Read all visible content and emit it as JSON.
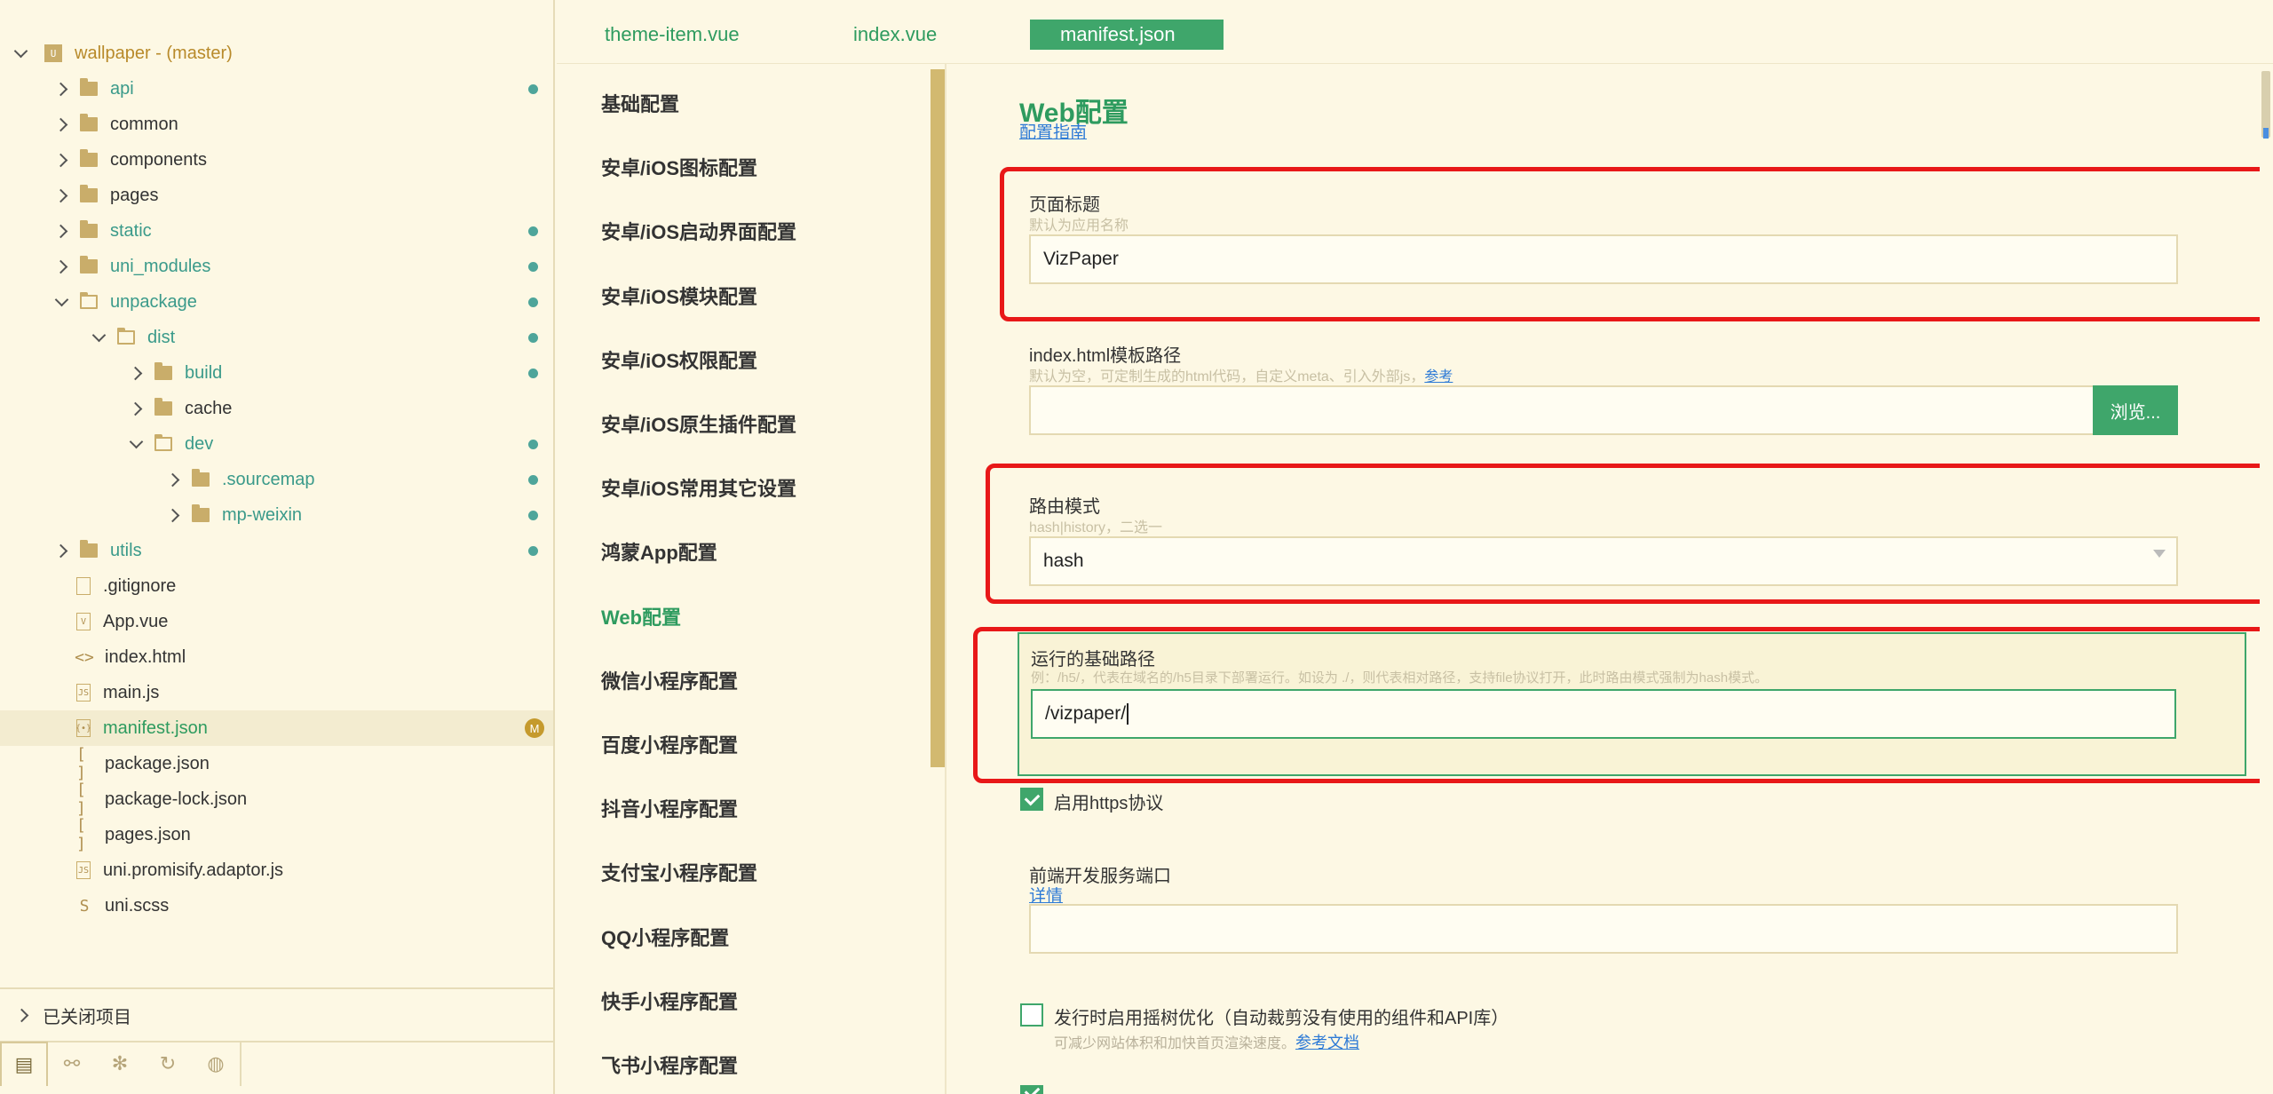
{
  "project": {
    "name": "wallpaper",
    "branch": " - (master)"
  },
  "file_tree": [
    {
      "label": "api",
      "kind": "folder",
      "depth": 1,
      "expanded": false,
      "color": "teal",
      "dot": true
    },
    {
      "label": "common",
      "kind": "folder",
      "depth": 1,
      "expanded": false,
      "color": "dark",
      "dot": false
    },
    {
      "label": "components",
      "kind": "folder",
      "depth": 1,
      "expanded": false,
      "color": "dark",
      "dot": false
    },
    {
      "label": "pages",
      "kind": "folder",
      "depth": 1,
      "expanded": false,
      "color": "dark",
      "dot": false
    },
    {
      "label": "static",
      "kind": "folder",
      "depth": 1,
      "expanded": false,
      "color": "teal",
      "dot": true
    },
    {
      "label": "uni_modules",
      "kind": "folder",
      "depth": 1,
      "expanded": false,
      "color": "teal",
      "dot": true
    },
    {
      "label": "unpackage",
      "kind": "folder",
      "depth": 1,
      "expanded": true,
      "color": "teal",
      "dot": true
    },
    {
      "label": "dist",
      "kind": "folder",
      "depth": 2,
      "expanded": true,
      "color": "teal",
      "dot": true
    },
    {
      "label": "build",
      "kind": "folder",
      "depth": 3,
      "expanded": false,
      "color": "teal",
      "dot": true
    },
    {
      "label": "cache",
      "kind": "folder",
      "depth": 3,
      "expanded": false,
      "color": "dark",
      "dot": false
    },
    {
      "label": "dev",
      "kind": "folder",
      "depth": 3,
      "expanded": true,
      "color": "teal",
      "dot": true
    },
    {
      "label": ".sourcemap",
      "kind": "folder",
      "depth": 4,
      "expanded": false,
      "color": "teal",
      "dot": true
    },
    {
      "label": "mp-weixin",
      "kind": "folder",
      "depth": 4,
      "expanded": false,
      "color": "teal",
      "dot": true
    },
    {
      "label": "utils",
      "kind": "folder",
      "depth": 1,
      "expanded": false,
      "color": "teal",
      "dot": true
    },
    {
      "label": ".gitignore",
      "kind": "file",
      "depth": 1,
      "icon": "",
      "color": "dark"
    },
    {
      "label": "App.vue",
      "kind": "file",
      "depth": 1,
      "icon": "V",
      "color": "dark"
    },
    {
      "label": "index.html",
      "kind": "file",
      "depth": 1,
      "icon": "<>",
      "color": "dark",
      "bare": true
    },
    {
      "label": "main.js",
      "kind": "file",
      "depth": 1,
      "icon": "JS",
      "color": "dark"
    },
    {
      "label": "manifest.json",
      "kind": "file",
      "depth": 1,
      "icon": "{•}",
      "color": "green",
      "selected": true,
      "badge": "M"
    },
    {
      "label": "package.json",
      "kind": "file",
      "depth": 1,
      "icon": "[ ]",
      "color": "dark",
      "bare": true
    },
    {
      "label": "package-lock.json",
      "kind": "file",
      "depth": 1,
      "icon": "[ ]",
      "color": "dark",
      "bare": true
    },
    {
      "label": "pages.json",
      "kind": "file",
      "depth": 1,
      "icon": "[ ]",
      "color": "dark",
      "bare": true
    },
    {
      "label": "uni.promisify.adaptor.js",
      "kind": "file",
      "depth": 1,
      "icon": "JS",
      "color": "dark"
    },
    {
      "label": "uni.scss",
      "kind": "file",
      "depth": 1,
      "icon": "S",
      "color": "dark",
      "bare": true
    }
  ],
  "closed_projects": "已关闭项目",
  "bottom_toolbar": [
    {
      "icon": "project-files-icon",
      "glyph": "▤"
    },
    {
      "icon": "binoculars-icon",
      "glyph": "⚯"
    },
    {
      "icon": "bug-icon",
      "glyph": "✻"
    },
    {
      "icon": "refresh-search-icon",
      "glyph": "↻"
    },
    {
      "icon": "globe-icon",
      "glyph": "◍"
    }
  ],
  "tabs": [
    {
      "label": "theme-item.vue",
      "active": false
    },
    {
      "label": "index.vue",
      "active": false
    },
    {
      "label": "manifest.json",
      "active": true
    }
  ],
  "config_nav": [
    {
      "label": "基础配置",
      "active": false
    },
    {
      "label": "安卓/iOS图标配置",
      "active": false
    },
    {
      "label": "安卓/iOS启动界面配置",
      "active": false
    },
    {
      "label": "安卓/iOS模块配置",
      "active": false
    },
    {
      "label": "安卓/iOS权限配置",
      "active": false
    },
    {
      "label": "安卓/iOS原生插件配置",
      "active": false
    },
    {
      "label": "安卓/iOS常用其它设置",
      "active": false
    },
    {
      "label": "鸿蒙App配置",
      "active": false
    },
    {
      "label": "Web配置",
      "active": true
    },
    {
      "label": "微信小程序配置",
      "active": false
    },
    {
      "label": "百度小程序配置",
      "active": false
    },
    {
      "label": "抖音小程序配置",
      "active": false
    },
    {
      "label": "支付宝小程序配置",
      "active": false
    },
    {
      "label": "QQ小程序配置",
      "active": false
    },
    {
      "label": "快手小程序配置",
      "active": false
    },
    {
      "label": "飞书小程序配置",
      "active": false
    }
  ],
  "web_config": {
    "title": "Web配置",
    "guide_link": "配置指南",
    "page_title": {
      "label": "页面标题",
      "hint": "默认为应用名称",
      "value": "VizPaper"
    },
    "template_path": {
      "label": "index.html模板路径",
      "hint": "默认为空，可定制生成的html代码，自定义meta、引入外部js，",
      "hint_link": "参考",
      "value": "",
      "browse_label": "浏览..."
    },
    "router_mode": {
      "label": "路由模式",
      "hint": "hash|history，二选一",
      "value": "hash"
    },
    "base_path": {
      "label": "运行的基础路径",
      "hint": "例：/h5/，代表在域名的/h5目录下部署运行。如设为 ./，则代表相对路径，支持file协议打开，此时路由模式强制为hash模式。",
      "value": "/vizpaper/"
    },
    "https": {
      "label": "启用https协议",
      "checked": true
    },
    "dev_port": {
      "label": "前端开发服务端口",
      "link": "详情",
      "value": ""
    },
    "tree_shaking": {
      "label": "发行时启用摇树优化（自动裁剪没有使用的组件和API库）",
      "hint": "可减少网站体积和加快首页渲染速度。",
      "hint_link": "参考文档",
      "checked": false
    }
  },
  "colors": {
    "accent_green": "#3fa66b",
    "highlight_red": "#e81818",
    "background": "#fdf8e4",
    "folder": "#c9ad6a",
    "link_blue": "#2d7ad6"
  }
}
